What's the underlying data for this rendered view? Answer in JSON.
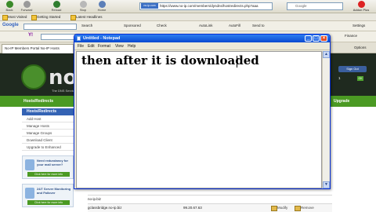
{
  "browser": {
    "nav_buttons": [
      {
        "label": "Back",
        "icon": "back-arrow-icon",
        "color": "#3b8a2a"
      },
      {
        "label": "Forward",
        "icon": "forward-arrow-icon",
        "color": "#9a9a9a"
      },
      {
        "label": "Reload",
        "icon": "reload-icon",
        "color": "#2f7d2f"
      },
      {
        "label": "Stop",
        "icon": "stop-icon",
        "color": "#b8b8b8"
      },
      {
        "label": "Home",
        "icon": "home-icon",
        "color": "#5c7fb8"
      }
    ],
    "url_site_badge": "no-ip.com",
    "url": "https://www.no-ip.com/members/dyndns/hostredirects.php?aaa",
    "search_placeholder": "Google",
    "addon_label": "Addon Plus"
  },
  "bookmarks": [
    "Most Visited",
    "Getting Started",
    "Latest Headlines"
  ],
  "google_toolbar": {
    "brand": "Google",
    "search_label": "Search",
    "items": [
      "Sponsored",
      "Check",
      "AutoLink",
      "AutoFill",
      "Send to",
      "Settings"
    ]
  },
  "yahoo_toolbar": {
    "brand": "Y!",
    "items": [
      "Finance",
      "Options"
    ]
  },
  "tab": {
    "label": "No-IP Members Portal No-IP Hosts"
  },
  "site": {
    "logo_text": "no",
    "logo_sub": "The DNS Service",
    "account_button": "Sign Out",
    "account_count": "1",
    "account_ok": "OK",
    "nav_left": "Hosts/Redirects",
    "nav_right": "Upgrade",
    "sidebar_head": "Hosts/Redirects",
    "sidebar_items": [
      "Add Host",
      "Manage Hosts",
      "Manage Groups",
      "Download Client",
      "Upgrade to Enhanced"
    ],
    "promo1": {
      "text": "Need redundancy for your mail server?",
      "button": "Click here for more info"
    },
    "promo2": {
      "text": "24/7 Server Monitoring and Failover",
      "button": "Click here for more info"
    },
    "row1": "no-ip.biz",
    "row2_host": "gclassbridge.no-ip.biz",
    "row2_ip": "99.20.67.63",
    "row2_modify": "Modify",
    "row2_remove": "Remove"
  },
  "notepad": {
    "title": "Untitled - Notepad",
    "menu": [
      "File",
      "Edit",
      "Format",
      "View",
      "Help"
    ],
    "text": "then after it is downloaded",
    "minimize_glyph": "_",
    "maximize_glyph": "□",
    "close_glyph": "×",
    "scroll_up_glyph": "▲",
    "scroll_down_glyph": "▼"
  }
}
